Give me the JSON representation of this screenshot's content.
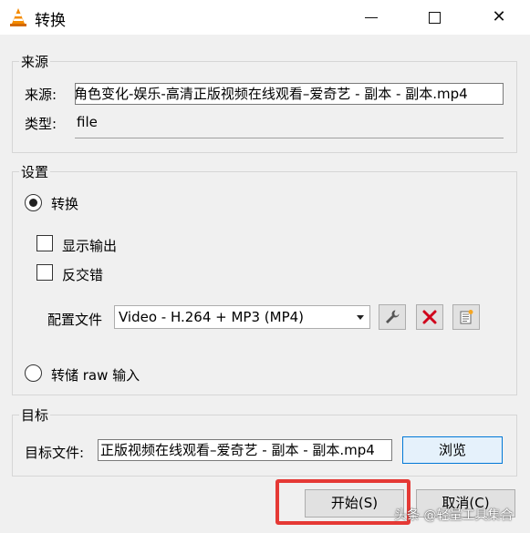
{
  "window": {
    "title": "转换",
    "icon": "vlc-cone-icon",
    "controls": {
      "minimize": "minimize-icon",
      "maximize": "maximize-icon",
      "close": "✕"
    }
  },
  "source": {
    "legend": "来源",
    "source_label": "来源:",
    "source_value": "​角色变化-娱乐-高清正版视频在线观看–爱奇艺 - 副本 - 副本.mp4",
    "type_label": "类型:",
    "type_value": "file"
  },
  "settings": {
    "legend": "设置",
    "convert_label": "转换",
    "show_output_label": "显示输出",
    "deinterlace_label": "反交错",
    "profile_label": "配置文件",
    "profile_value": "Video - H.264 + MP3 (MP4)",
    "dump_raw_label": "转储 raw 输入",
    "convert_selected": true,
    "show_output_checked": false,
    "deinterlace_checked": false
  },
  "destination": {
    "legend": "目标",
    "file_label": "目标文件:",
    "file_value": "正版视频在线观看–爱奇艺 - 副本 - 副本.mp4",
    "browse_label": "浏览"
  },
  "footer": {
    "start_label": "开始(S)",
    "cancel_label": "取消(C)"
  },
  "watermark": "头条 @轻量工具集合"
}
